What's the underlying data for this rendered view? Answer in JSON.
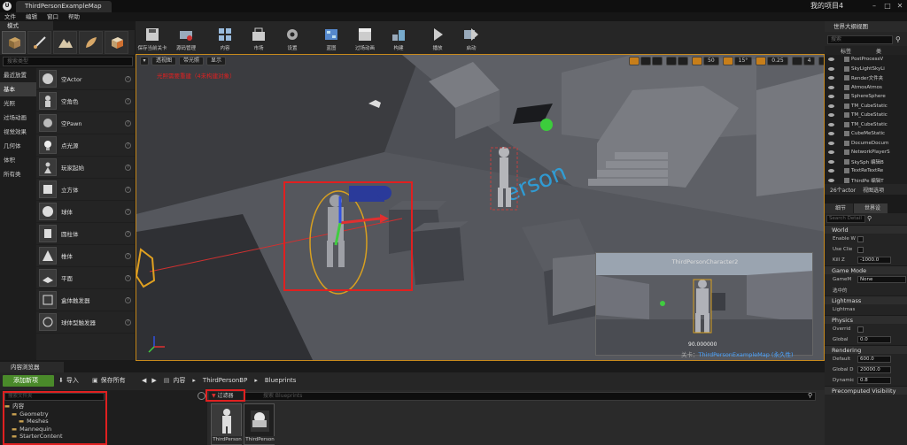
{
  "window": {
    "tab_title": "ThirdPersonExampleMap",
    "project_name": "我的项目4",
    "controls": [
      "–",
      "□",
      "✕"
    ]
  },
  "menu": [
    "文件",
    "编辑",
    "窗口",
    "帮助"
  ],
  "modes": {
    "tab_label": "模式",
    "search_placeholder": "搜索类型",
    "categories": [
      "最近放置",
      "基本",
      "光照",
      "过场动画",
      "视觉效果",
      "几何体",
      "体积",
      "所有类"
    ],
    "active_category": "基本",
    "items": [
      "空Actor",
      "空角色",
      "空Pawn",
      "点光源",
      "玩家起始",
      "立方体",
      "球体",
      "圆柱体",
      "椎体",
      "平面",
      "盒体触发器",
      "球体型触发器"
    ]
  },
  "toolbar": {
    "buttons": [
      "保存当前关卡",
      "源码管理",
      "内容",
      "市场",
      "设置",
      "蓝图",
      "过场动画",
      "构建",
      "播放",
      "启动"
    ]
  },
  "viewport": {
    "left_controls": [
      "透视图",
      "带光照",
      "显示"
    ],
    "right_values": [
      "50",
      "15°",
      "0.25",
      "4"
    ],
    "lighting_warning": "光照需要重建（4未构建对象）",
    "pip_title": "ThirdPersonCharacter2",
    "pip_fov": "90.000000",
    "level_prefix": "关卡：",
    "level_name": "ThirdPersonExampleMap (永久性)"
  },
  "outliner": {
    "tab_label": "世界大纲视图",
    "search_placeholder": "搜索",
    "col_label": "标签",
    "col_type": "类",
    "rows": [
      {
        "text": "PostProcessV",
        "sel": false
      },
      {
        "text": "SkyLightSkyLi",
        "sel": false
      },
      {
        "text": "Render文件夹",
        "sel": false
      },
      {
        "text": "AtmosAtmos",
        "sel": false
      },
      {
        "text": "SphereSphere",
        "sel": false
      },
      {
        "text": "TM_CubeStatic",
        "sel": false
      },
      {
        "text": "TM_CubeStatic",
        "sel": false
      },
      {
        "text": "TM_CubeStatic",
        "sel": false
      },
      {
        "text": "CubeMeStatic",
        "sel": false
      },
      {
        "text": "DocumeDocum",
        "sel": false
      },
      {
        "text": "NetworkPlayerS",
        "sel": false
      },
      {
        "text": "SkySph 编辑B",
        "sel": false
      },
      {
        "text": "TextReTextRe",
        "sel": false
      },
      {
        "text": "ThirdPe 编辑T",
        "sel": false
      },
      {
        "text": "ThirdPe 编辑T",
        "sel": true
      }
    ],
    "count": "26个actor",
    "view_options": "视图选项"
  },
  "details": {
    "tabs": [
      "细节",
      "世界设"
    ],
    "search_placeholder": "Search Detail",
    "sections": [
      {
        "title": "World",
        "rows": [
          {
            "label": "Enable W",
            "type": "check"
          },
          {
            "label": "Use Clie",
            "type": "check"
          },
          {
            "label": "Kill Z",
            "type": "num",
            "value": "-1000.0"
          }
        ]
      },
      {
        "title": "Game Mode",
        "rows": [
          {
            "label": "GameM",
            "type": "select",
            "value": "None"
          },
          {
            "label": "选中的",
            "type": "none"
          }
        ]
      },
      {
        "title": "Lightmass",
        "rows": [
          {
            "label": "Lightmas",
            "type": "none"
          }
        ]
      },
      {
        "title": "Physics",
        "rows": [
          {
            "label": "Overrid",
            "type": "check"
          },
          {
            "label": "Global",
            "type": "num",
            "value": "0.0"
          }
        ]
      },
      {
        "title": "Rendering",
        "rows": [
          {
            "label": "Default",
            "type": "num",
            "value": "600.0"
          },
          {
            "label": "Global D",
            "type": "num",
            "value": "20000.0"
          },
          {
            "label": "Dynamic",
            "type": "num",
            "value": "0.8"
          }
        ]
      },
      {
        "title": "Precomputed Visibility",
        "rows": []
      }
    ]
  },
  "content_browser": {
    "tab_label": "内容浏览器",
    "add_new": "添加新项",
    "import": "导入",
    "save_all": "保存所有",
    "path": [
      "内容",
      "ThirdPersonBP",
      "Blueprints"
    ],
    "left_search_placeholder": "搜索文件夹",
    "tree": [
      {
        "text": "内容",
        "indent": 0
      },
      {
        "text": "Geometry",
        "indent": 1
      },
      {
        "text": "Meshes",
        "indent": 2
      },
      {
        "text": "Mannequin",
        "indent": 1
      },
      {
        "text": "StarterContent",
        "indent": 1
      }
    ],
    "filter_label": "过滤器",
    "right_search_placeholder": "搜索 Blueprints",
    "assets": [
      "ThirdPerson",
      "ThirdPerson"
    ]
  },
  "colors": {
    "accent_orange": "#c77e1a",
    "warning_red": "#e02020",
    "add_green": "#4a8a2a",
    "link_blue": "#4aa3ff"
  }
}
